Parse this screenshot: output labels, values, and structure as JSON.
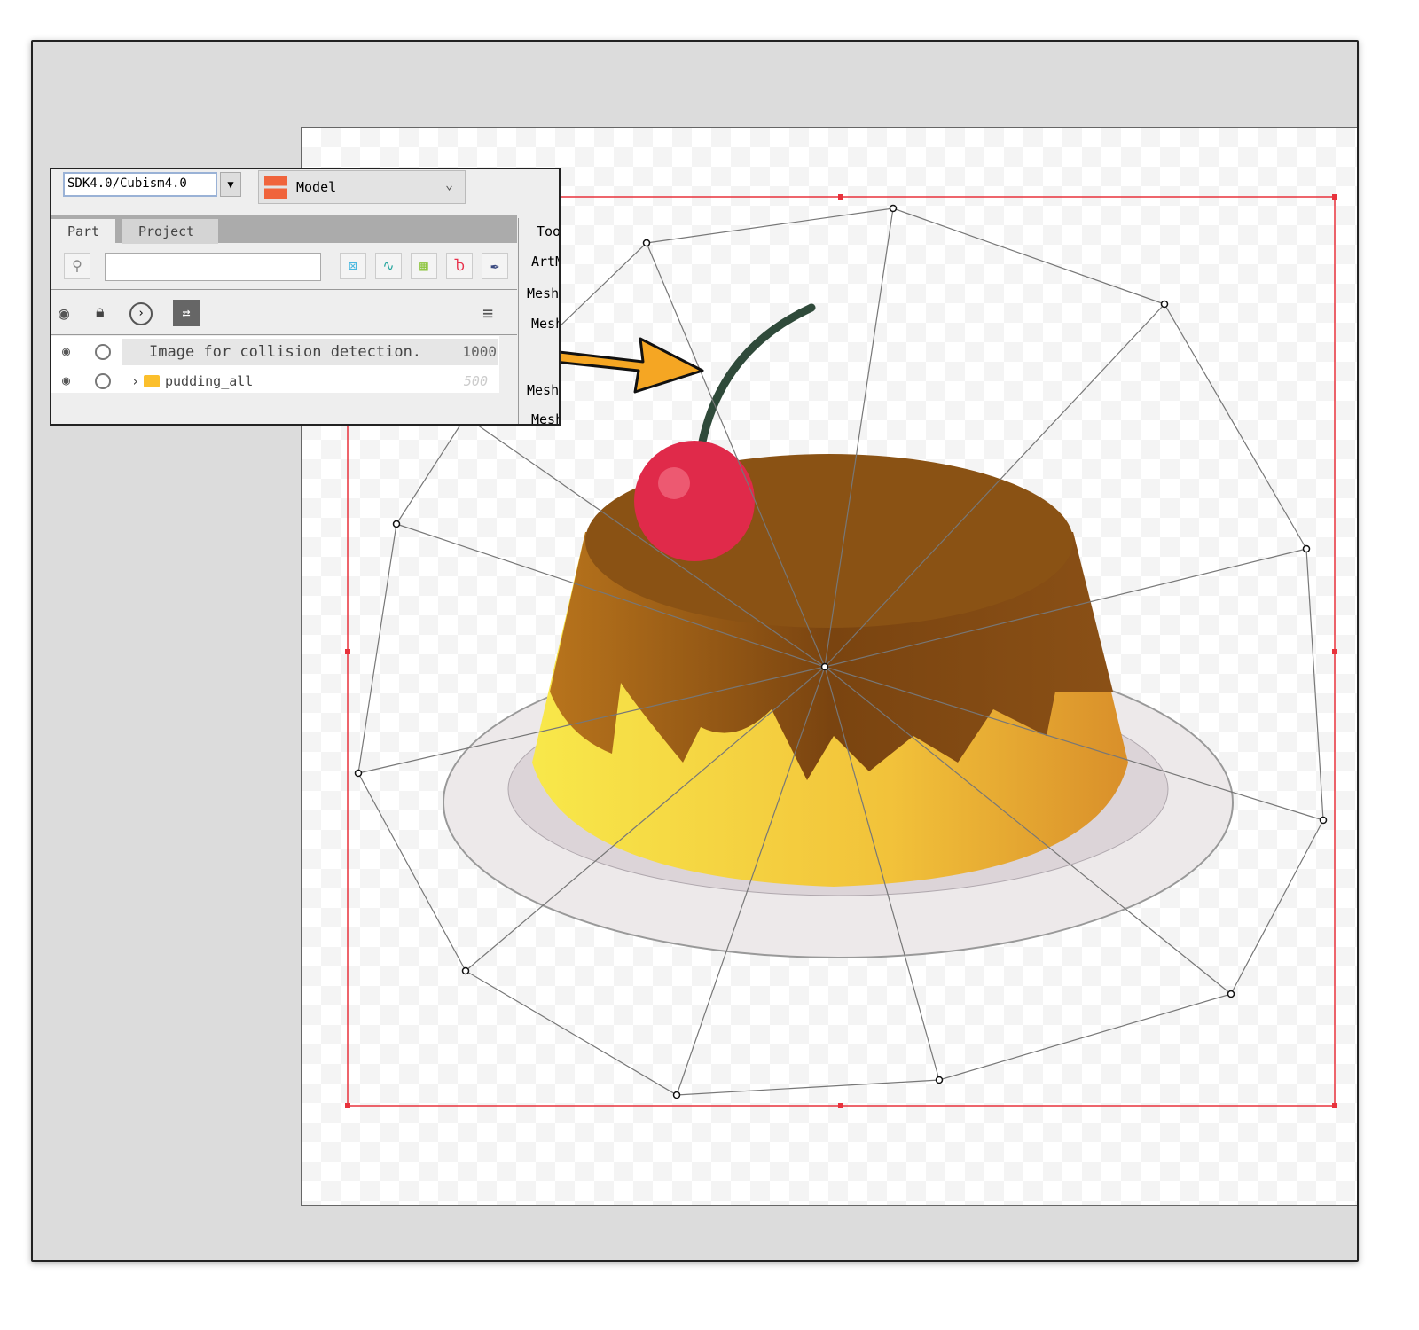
{
  "panel": {
    "sdk_version": "SDK4.0/Cubism4.0",
    "model_label": "Model",
    "tabs": [
      "Part",
      "Project"
    ],
    "search_placeholder": "",
    "toolbar_icons": [
      "deformer-select-icon",
      "curve-icon",
      "warp-grid-icon",
      "rotation-icon",
      "pen-icon"
    ],
    "header_icons": [
      "eye-icon",
      "lock-icon",
      "chevron-circle-icon",
      "swap-icon",
      "menu-icon"
    ],
    "rows": [
      {
        "name": "Image for collision detection.",
        "order": "1000"
      },
      {
        "name": "pudding_all",
        "order": "500"
      }
    ],
    "side_tab": "Too",
    "side_items": [
      "ArtM",
      "Mesh",
      "Mesh",
      "Mesh",
      "Mesh"
    ]
  },
  "colors": {
    "bbox": "#e8323c",
    "arrow": "#f5a623",
    "accent_folder": "#fbbf2c"
  }
}
